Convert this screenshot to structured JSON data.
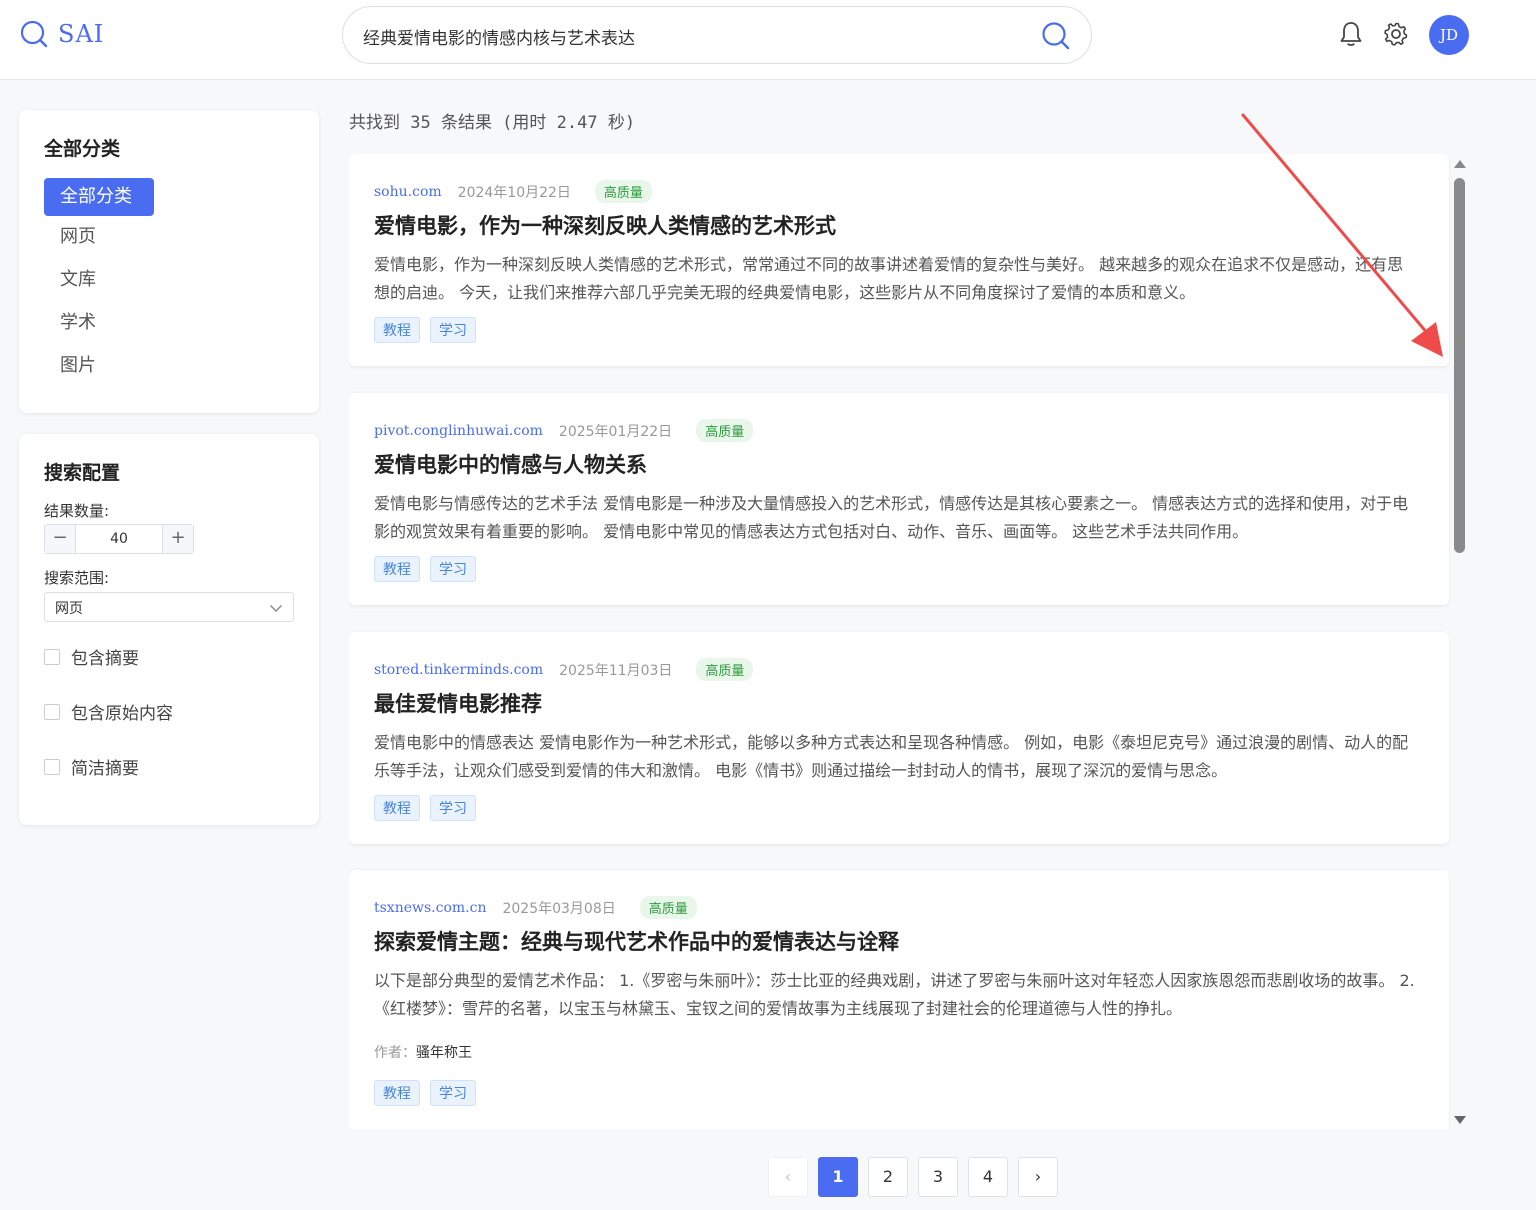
{
  "header": {
    "logo_text": "SAI",
    "search_value": "经典爱情电影的情感内核与艺术表达",
    "avatar_initials": "JD"
  },
  "sidebar": {
    "categories_title": "全部分类",
    "categories": [
      {
        "label": "全部分类",
        "active": true
      },
      {
        "label": "网页",
        "active": false
      },
      {
        "label": "文库",
        "active": false
      },
      {
        "label": "学术",
        "active": false
      },
      {
        "label": "图片",
        "active": false
      }
    ],
    "config_title": "搜索配置",
    "result_count_label": "结果数量:",
    "result_count_value": "40",
    "minus": "−",
    "plus": "+",
    "scope_label": "搜索范围:",
    "scope_value": "网页",
    "checkboxes": [
      {
        "label": "包含摘要",
        "checked": false
      },
      {
        "label": "包含原始内容",
        "checked": false
      },
      {
        "label": "简洁摘要",
        "checked": false
      }
    ]
  },
  "results": {
    "summary": "共找到 35 条结果 (用时 2.47 秒)",
    "items": [
      {
        "domain": "sohu.com",
        "date": "2024年10月22日",
        "quality": "高质量",
        "title": "爱情电影，作为一种深刻反映人类情感的艺术形式",
        "snippet": "爱情电影，作为一种深刻反映人类情感的艺术形式，常常通过不同的故事讲述着爱情的复杂性与美好。 越来越多的观众在追求不仅是感动，还有思想的启迪。 今天，让我们来推荐六部几乎完美无瑕的经典爱情电影，这些影片从不同角度探讨了爱情的本质和意义。",
        "author_label": "",
        "author": "",
        "tags": [
          "教程",
          "学习"
        ]
      },
      {
        "domain": "pivot.conglinhuwai.com",
        "date": "2025年01月22日",
        "quality": "高质量",
        "title": "爱情电影中的情感与人物关系",
        "snippet": "爱情电影与情感传达的艺术手法 爱情电影是一种涉及大量情感投入的艺术形式，情感传达是其核心要素之一。 情感表达方式的选择和使用，对于电影的观赏效果有着重要的影响。 爱情电影中常见的情感表达方式包括对白、动作、音乐、画面等。 这些艺术手法共同作用。",
        "author_label": "",
        "author": "",
        "tags": [
          "教程",
          "学习"
        ]
      },
      {
        "domain": "stored.tinkerminds.com",
        "date": "2025年11月03日",
        "quality": "高质量",
        "title": "最佳爱情电影推荐",
        "snippet": "爱情电影中的情感表达 爱情电影作为一种艺术形式，能够以多种方式表达和呈现各种情感。 例如，电影《泰坦尼克号》通过浪漫的剧情、动人的配乐等手法，让观众们感受到爱情的伟大和激情。 电影《情书》则通过描绘一封封动人的情书，展现了深沉的爱情与思念。",
        "author_label": "",
        "author": "",
        "tags": [
          "教程",
          "学习"
        ]
      },
      {
        "domain": "tsxnews.com.cn",
        "date": "2025年03月08日",
        "quality": "高质量",
        "title": "探索爱情主题：经典与现代艺术作品中的爱情表达与诠释",
        "snippet": "以下是部分典型的爱情艺术作品： 1.《罗密与朱丽叶》：莎士比亚的经典戏剧，讲述了罗密与朱丽叶这对年轻恋人因家族恩怨而悲剧收场的故事。 2.《红楼梦》：雪芹的名著，以宝玉与林黛玉、宝钗之间的爱情故事为主线展现了封建社会的伦理道德与人性的挣扎。",
        "author_label": "作者：",
        "author": "骚年称王",
        "tags": [
          "教程",
          "学习"
        ]
      }
    ]
  },
  "pagination": {
    "prev": "‹",
    "pages": [
      "1",
      "2",
      "3",
      "4"
    ],
    "current": "1",
    "next": "›"
  },
  "colors": {
    "accent": "#4a6cf0",
    "quality_bg": "#e8f7ea",
    "quality_text": "#2e9b3e",
    "tag_text": "#4a86d6",
    "annotation_arrow": "#ef4b4b"
  },
  "icons": [
    "search-icon",
    "bell-icon",
    "gear-icon",
    "chevron-down-icon",
    "chevron-left-icon",
    "chevron-right-icon"
  ]
}
